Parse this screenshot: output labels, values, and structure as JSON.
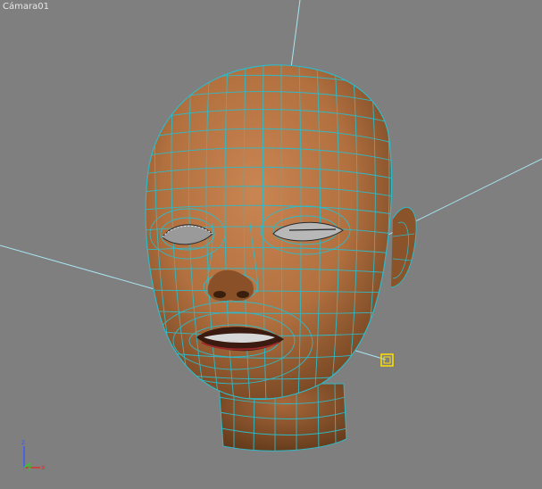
{
  "viewport": {
    "label": "Cámara01",
    "background": "#7f7f7f"
  },
  "model": {
    "skin_color": "#b8733f",
    "wire_color": "#2fb9c7"
  },
  "gizmo": {
    "axes": [
      {
        "name": "z",
        "label": "z",
        "color": "#3a5bff"
      },
      {
        "name": "y",
        "label": "y",
        "color": "#2bd12b"
      },
      {
        "name": "x",
        "label": "x",
        "color": "#e03030"
      }
    ]
  },
  "light": {
    "icon": "light-icon",
    "color": "#ffe000"
  }
}
